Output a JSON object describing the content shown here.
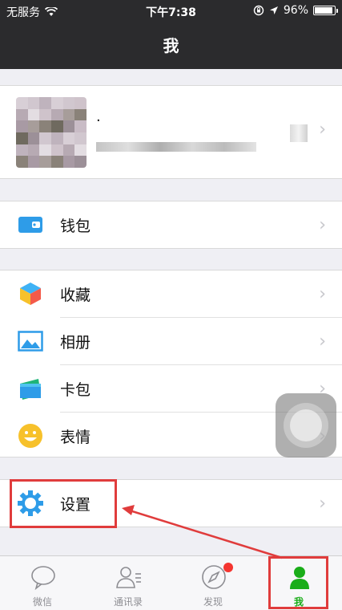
{
  "status_bar": {
    "carrier": "无服务",
    "time": "下午7:38",
    "battery": "96%",
    "battery_level": 0.96
  },
  "nav": {
    "title": "我"
  },
  "profile": {
    "name": "."
  },
  "menu": {
    "wallet": {
      "label": "钱包",
      "icon": "wallet-icon",
      "color": "#2e9ce8"
    },
    "favorites": {
      "label": "收藏",
      "icon": "favorites-cube-icon"
    },
    "album": {
      "label": "相册",
      "icon": "album-icon",
      "color": "#2e9ce8"
    },
    "cards": {
      "label": "卡包",
      "icon": "card-icon"
    },
    "emoji": {
      "label": "表情",
      "icon": "emoji-icon",
      "color": "#f7c12b"
    },
    "settings": {
      "label": "设置",
      "icon": "gear-icon",
      "color": "#2e9ce8"
    }
  },
  "chevron": "›",
  "tabs": [
    {
      "label": "微信",
      "icon": "chat-bubble-icon"
    },
    {
      "label": "通讯录",
      "icon": "contacts-icon"
    },
    {
      "label": "发现",
      "icon": "compass-icon"
    },
    {
      "label": "我",
      "icon": "person-icon",
      "active": true
    }
  ],
  "colors": {
    "accent_green": "#1aad19",
    "highlight_red": "#e03c3c",
    "badge_red": "#f43530"
  }
}
